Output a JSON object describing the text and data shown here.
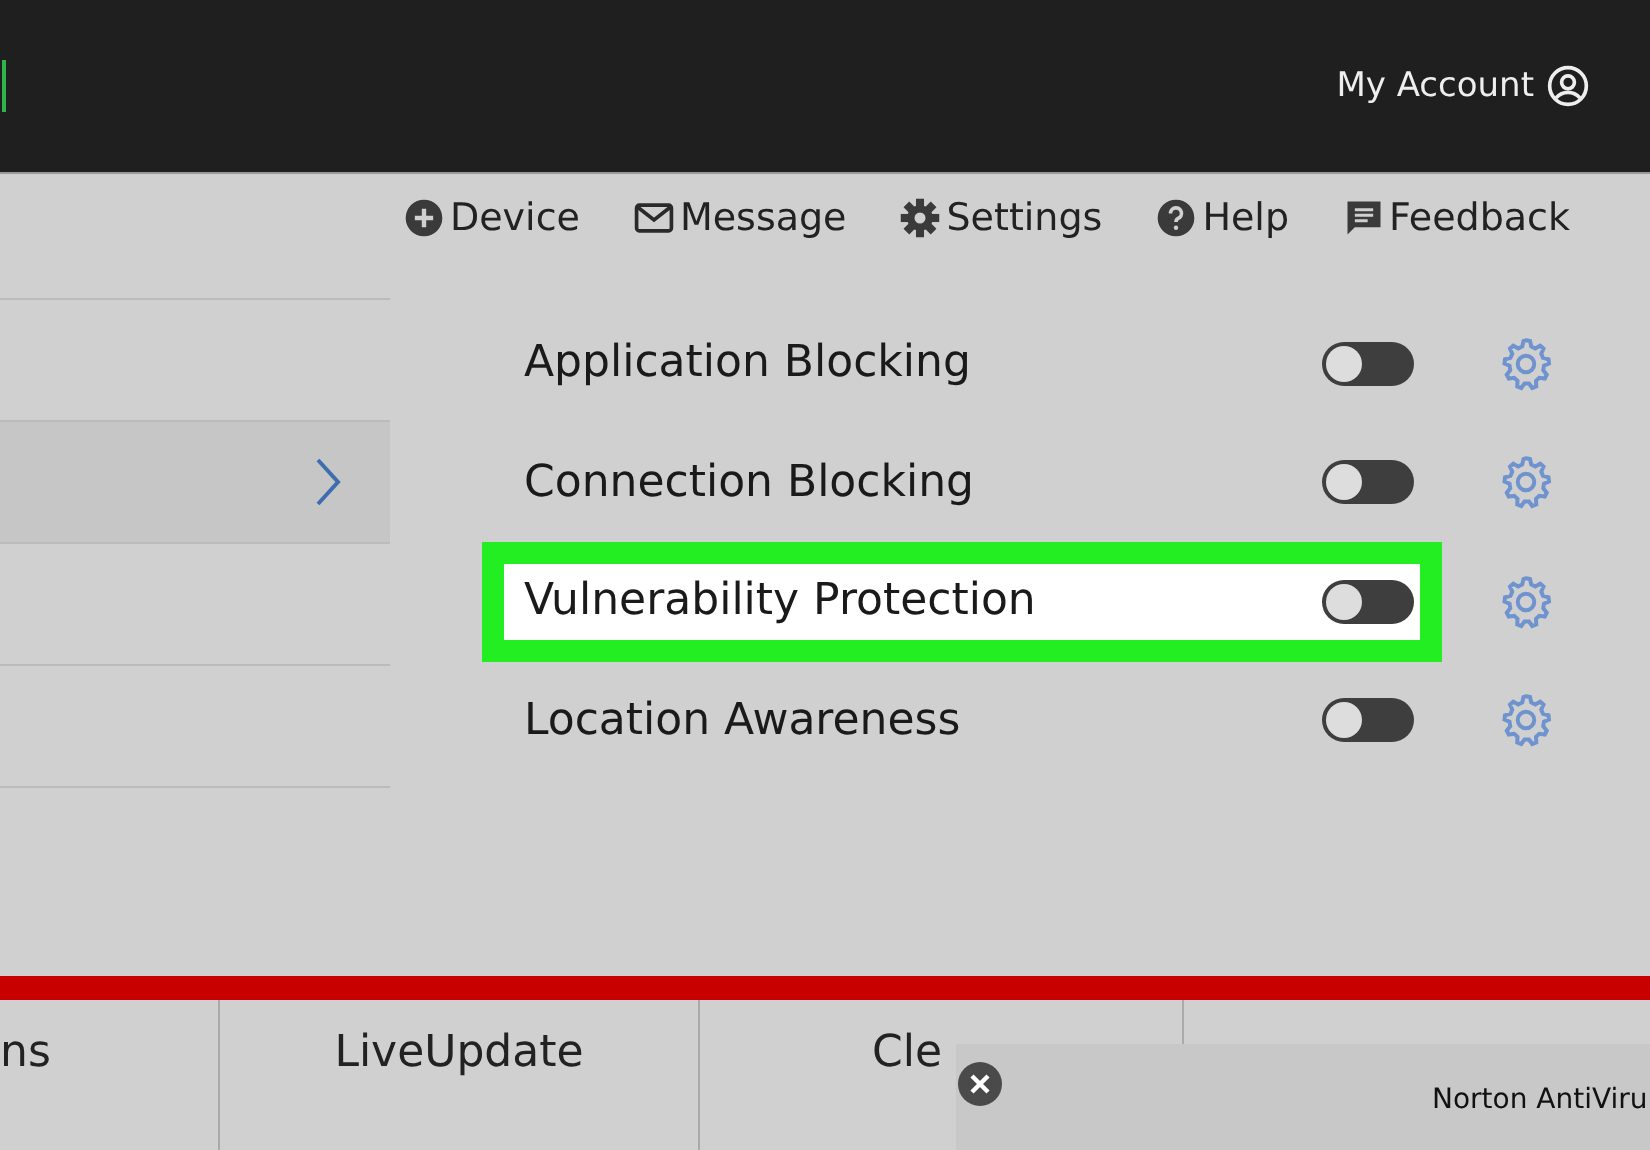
{
  "header": {
    "account": "My Account"
  },
  "toolbar": [
    {
      "kind": "device",
      "label": "Device"
    },
    {
      "kind": "message",
      "label": "Message"
    },
    {
      "kind": "settings",
      "label": "Settings"
    },
    {
      "kind": "help",
      "label": "Help"
    },
    {
      "kind": "feedback",
      "label": "Feedback"
    }
  ],
  "sidebar": {
    "items": [
      {
        "expanded": false
      },
      {
        "expanded": true
      },
      {
        "expanded": false
      },
      {
        "expanded": false
      }
    ]
  },
  "features": [
    {
      "label": "Application Blocking",
      "on": false,
      "highlighted": false
    },
    {
      "label": "Connection Blocking",
      "on": false,
      "highlighted": false
    },
    {
      "label": "Vulnerability Protection",
      "on": false,
      "highlighted": true
    },
    {
      "label": "Location Awareness",
      "on": false,
      "highlighted": false
    }
  ],
  "bottom_tabs": [
    {
      "label": "ns"
    },
    {
      "label": "LiveUpdate"
    },
    {
      "label": "Cle"
    }
  ],
  "notification": {
    "title": "Norton AntiViru"
  }
}
